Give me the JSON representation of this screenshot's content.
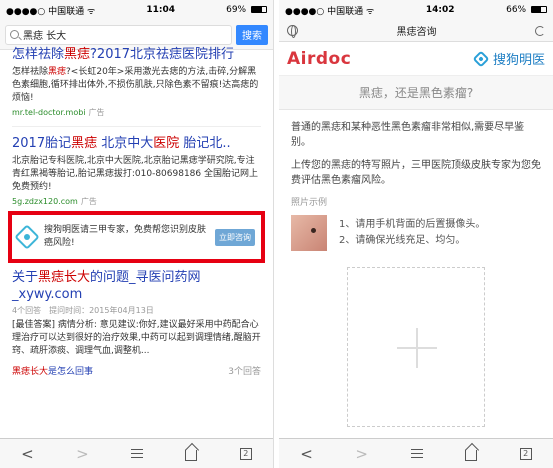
{
  "left": {
    "status": {
      "carrier": "●●●●○ 中国联通 ᯤ",
      "time": "11:04",
      "battery": "69%",
      "battery_level": 0.69
    },
    "search": {
      "query": "黑痣 长大",
      "button": "搜索"
    },
    "result1": {
      "title_a": "怎样祛除",
      "title_hl": "黑痣",
      "title_b": "?2017北京祛痣医院排行",
      "body_a": "怎样祛除",
      "body_hl": "黑痣",
      "body_b": "?<长虹20年>采用激光去痣的方法,击碎,分解黑色素细胞,循环排出体外,不损伤肌肤,只除色素不留痕!达高痣的烦恼!",
      "url": "mr.tel-doctor.mobi",
      "ad": "广告"
    },
    "result2": {
      "title_a": "2017胎记",
      "title_hl1": "黑痣",
      "title_b": " 北京中大",
      "title_hl2": "医院",
      "title_c": " 胎记北..",
      "body": "北京胎记专科医院,北京中大医院,北京胎记黑痣学研究院,专注青红黑褐等胎记,胎记黑痣拔打:010-80698186 全国胎记网上免费预约!",
      "url": "5g.zdzx120.com",
      "ad": "广告"
    },
    "adbox": {
      "text": "搜狗明医请三甲专家，免费帮您识别皮肤癌风险!",
      "button": "立即咨询"
    },
    "result3": {
      "title_a": "关于",
      "title_hl": "黑痣长大",
      "title_b": "的问题_寻医问药网_xywy.com",
      "meta": "4个回答　提问时间：2015年04月13日",
      "body": "[最佳答案] 病情分析: 意见建议:你好,建议最好采用中药配合心理治疗可以达到很好的治疗效果,中药可以起到调理情绪,醒脑开窍、疏肝添痰、调理气血,调整机...",
      "link_hl": "黑痣长大",
      "link_b": "是怎么回事",
      "count": "3个回答"
    },
    "toolbar": {
      "back": "<",
      "forward": ">",
      "tabs": "2"
    }
  },
  "right": {
    "status": {
      "carrier": "●●●●○ 中国联通 ᯤ",
      "time": "14:02",
      "battery": "66%",
      "battery_level": 0.66
    },
    "titlebar": {
      "title": "黑痣咨询"
    },
    "brand": {
      "airdoc": "Airdoc",
      "sogou": "搜狗明医"
    },
    "question": "黑痣，还是黑色素瘤?",
    "para1": "普通的黑痣和某种恶性黑色素瘤非常相似,需要尽早鉴别。",
    "para2": "上传您的黑痣的特写照片，三甲医院顶级皮肤专家为您免费评估黑色素瘤风险。",
    "sample_label": "照片示例",
    "tip1": "1、请用手机背面的后置摄像头。",
    "tip2": "2、请确保光线充足、均匀。",
    "toolbar": {
      "back": "<",
      "forward": ">",
      "tabs": "2"
    }
  }
}
